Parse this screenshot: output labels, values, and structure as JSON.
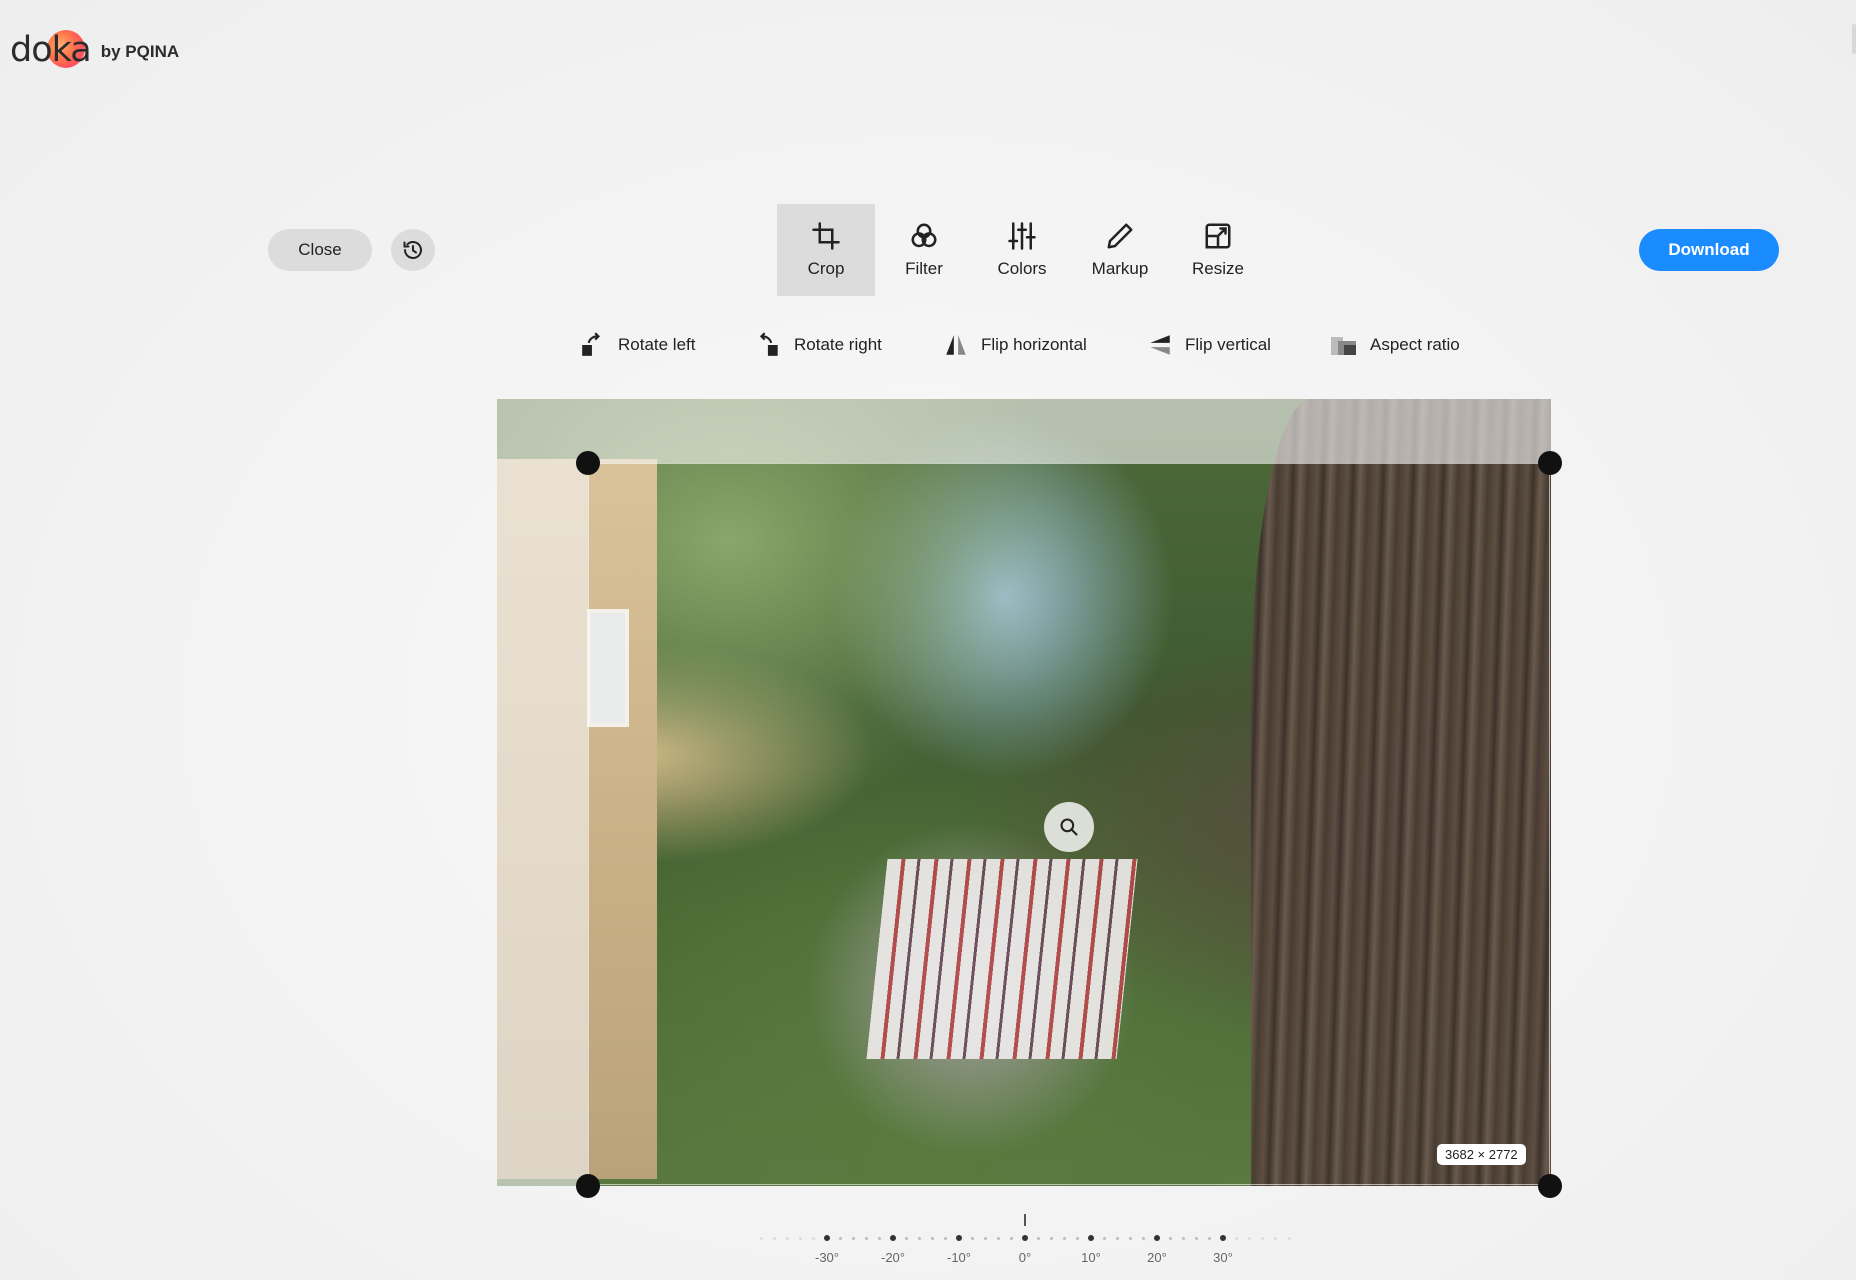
{
  "brand": {
    "wordmark": "doka",
    "byline": "by PQINA",
    "accent": "#ff5a5a"
  },
  "header": {
    "close_label": "Close",
    "history_icon": "history-icon",
    "download_label": "Download",
    "download_color": "#1a8cff"
  },
  "tools": [
    {
      "id": "crop",
      "label": "Crop",
      "icon": "crop-icon",
      "active": true
    },
    {
      "id": "filter",
      "label": "Filter",
      "icon": "filter-icon",
      "active": false
    },
    {
      "id": "colors",
      "label": "Colors",
      "icon": "sliders-icon",
      "active": false
    },
    {
      "id": "markup",
      "label": "Markup",
      "icon": "pencil-icon",
      "active": false
    },
    {
      "id": "resize",
      "label": "Resize",
      "icon": "resize-icon",
      "active": false
    }
  ],
  "crop_tools": [
    {
      "label": "Rotate left",
      "icon": "rotate-left-icon"
    },
    {
      "label": "Rotate right",
      "icon": "rotate-right-icon"
    },
    {
      "label": "Flip horizontal",
      "icon": "flip-horizontal-icon"
    },
    {
      "label": "Flip vertical",
      "icon": "flip-vertical-icon"
    },
    {
      "label": "Aspect ratio",
      "icon": "aspect-ratio-icon"
    }
  ],
  "canvas": {
    "dimensions": "3682 × 2772",
    "zoom_icon": "magnifier-icon"
  },
  "rotation_dial": {
    "value_deg": 0,
    "labels": [
      "-30°",
      "-20°",
      "-10°",
      "0°",
      "10°",
      "20°",
      "30°"
    ]
  }
}
